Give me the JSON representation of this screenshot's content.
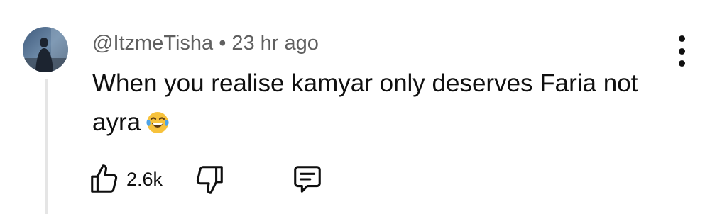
{
  "comment": {
    "author": "@ItzmeTisha",
    "separator": "•",
    "timestamp": "23 hr ago",
    "text": "When you realise kamyar only deserves Faria not ayra",
    "emoji": "face-with-tears-of-joy",
    "like_count": "2.6k"
  },
  "icons": {
    "like": "thumbs-up-outline-icon",
    "dislike": "thumbs-down-outline-icon",
    "reply": "reply-comment-icon",
    "more": "vertical-ellipsis-icon"
  },
  "colors": {
    "text_primary": "#0f0f0f",
    "text_secondary": "#606060",
    "thread_line": "#e5e5e5",
    "emoji_yellow": "#f7c23c",
    "emoji_tear": "#4fa4e8"
  }
}
